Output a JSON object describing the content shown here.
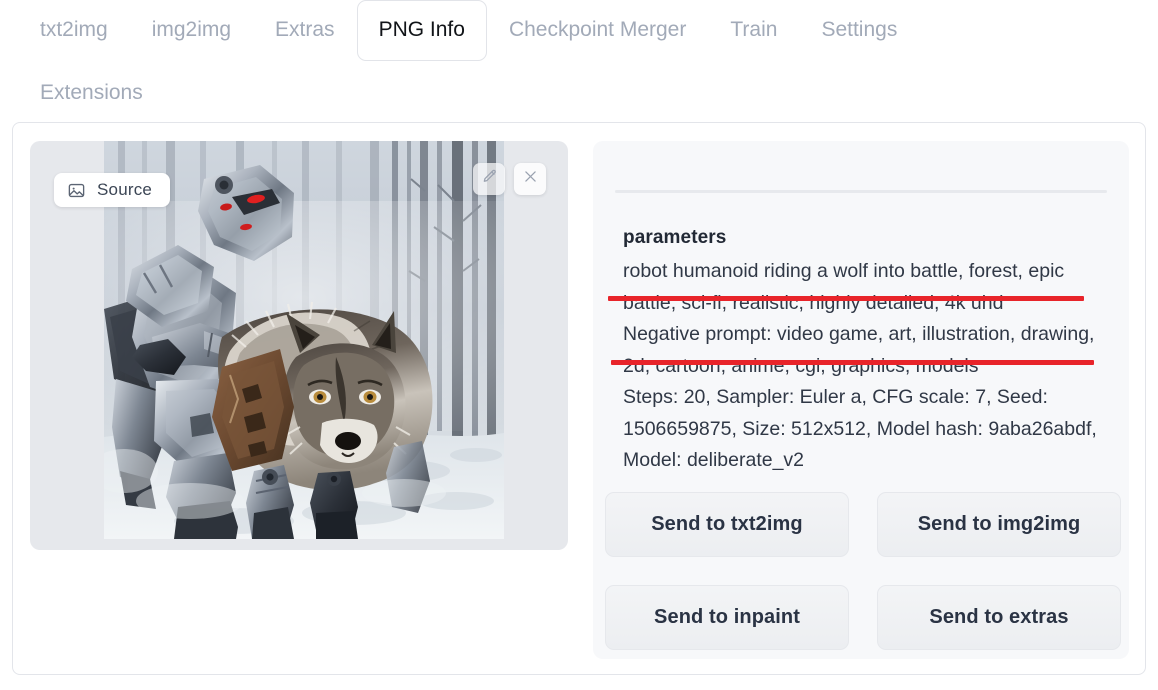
{
  "tabs": {
    "row1": [
      {
        "label": "txt2img",
        "active": false
      },
      {
        "label": "img2img",
        "active": false
      },
      {
        "label": "Extras",
        "active": false
      },
      {
        "label": "PNG Info",
        "active": true
      },
      {
        "label": "Checkpoint Merger",
        "active": false
      },
      {
        "label": "Train",
        "active": false
      },
      {
        "label": "Settings",
        "active": false
      }
    ],
    "row2": [
      {
        "label": "Extensions",
        "active": false
      }
    ]
  },
  "image_panel": {
    "source_badge_label": "Source",
    "source_icon": "image-icon",
    "edit_icon": "pencil-icon",
    "close_icon": "close-icon",
    "image_alt": "robot humanoid riding a wolf through a snowy forest"
  },
  "info_panel": {
    "params_title": "parameters",
    "params_text": "robot humanoid riding a wolf into battle, forest, epic battle, sci-fi, realistic, highly detailed, 4k uhd\nNegative prompt: video game, art, illustration, drawing, 2d, cartoon, anime, cgi, graphics, models\nSteps: 20, Sampler: Euler a, CFG scale: 7, Seed: 1506659875, Size: 512x512, Model hash: 9aba26abdf, Model: deliberate_v2",
    "parsed": {
      "prompt": "robot humanoid riding a wolf into battle, forest, epic battle, sci-fi, realistic, highly detailed, 4k uhd",
      "negative_prompt": "video game, art, illustration, drawing, 2d, cartoon, anime, cgi, graphics, models",
      "steps": "20",
      "sampler": "Euler a",
      "cfg_scale": "7",
      "seed": "1506659875",
      "size": "512x512",
      "model_hash": "9aba26abdf",
      "model": "deliberate_v2"
    },
    "highlight_color": "#e8242a",
    "highlighted_lines": [
      "epic battle, sci-fi, realistic, highly detailed, 4k uhd",
      "drawing, 2d, cartoon, anime, cgi, graphics, models"
    ]
  },
  "buttons": [
    {
      "label": "Send to txt2img"
    },
    {
      "label": "Send to img2img"
    },
    {
      "label": "Send to inpaint"
    },
    {
      "label": "Send to extras"
    }
  ]
}
